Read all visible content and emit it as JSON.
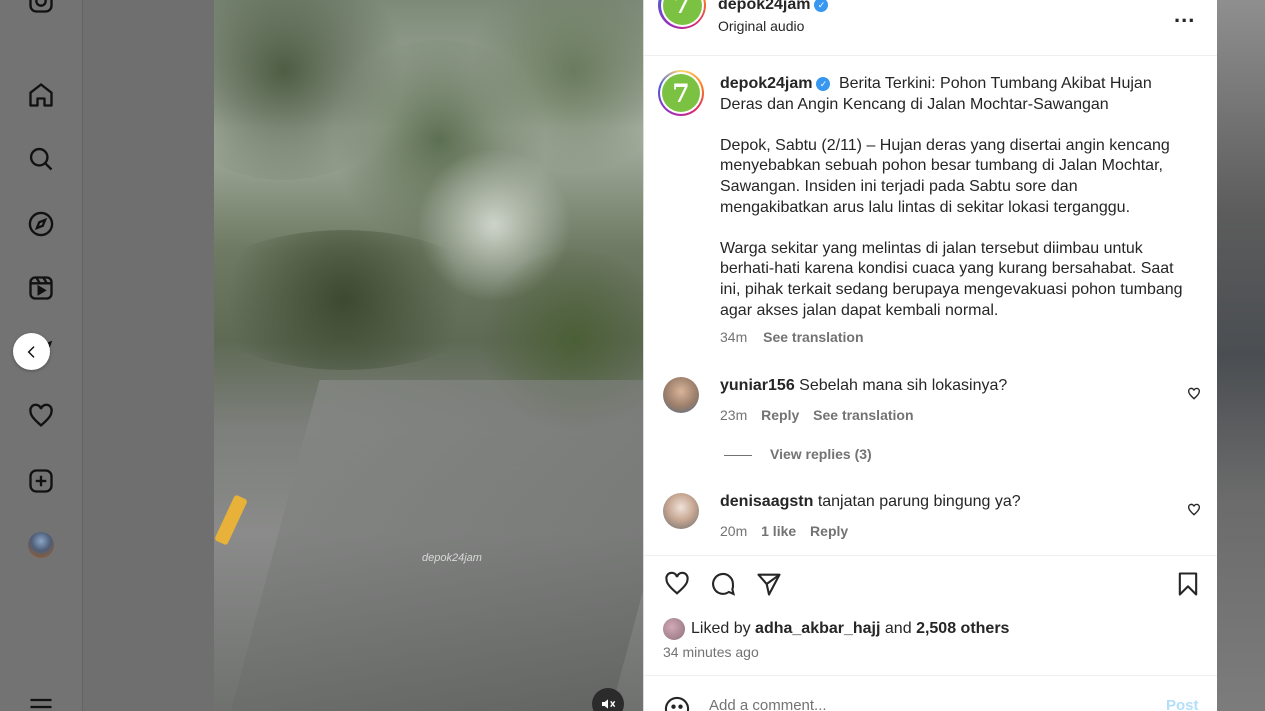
{
  "header": {
    "username": "depok24jam",
    "audio": "Original audio",
    "more_label": "..."
  },
  "caption": {
    "username": "depok24jam",
    "headline": "Berita Terkini: Pohon Tumbang Akibat Hujan Deras dan Angin Kencang di Jalan Mochtar-Sawangan",
    "paragraph_1": "Depok, Sabtu (2/11) – Hujan deras yang disertai angin kencang menyebabkan sebuah pohon besar tumbang di Jalan Mochtar, Sawangan. Insiden ini terjadi pada Sabtu sore dan mengakibatkan arus lalu lintas di sekitar lokasi terganggu.",
    "paragraph_2": "Warga sekitar yang melintas di jalan tersebut diimbau untuk berhati-hati karena kondisi cuaca yang kurang bersahabat. Saat ini, pihak terkait sedang berupaya mengevakuasi pohon tumbang agar akses jalan dapat kembali normal.",
    "time": "34m",
    "see_translation": "See translation"
  },
  "comments": [
    {
      "username": "yuniar156",
      "text": "Sebelah mana sih lokasinya?",
      "time": "23m",
      "reply": "Reply",
      "see_translation": "See translation",
      "view_replies": "View replies (3)"
    },
    {
      "username": "denisaagstn",
      "text": "tanjatan parung bingung ya?",
      "time": "20m",
      "likes": "1 like",
      "reply": "Reply"
    }
  ],
  "likes": {
    "prefix": "Liked by",
    "user": "adha_akbar_hajj",
    "and": "and",
    "others": "2,508 others"
  },
  "timestamp": "34 minutes ago",
  "add_comment": {
    "placeholder": "Add a comment...",
    "post": "Post"
  },
  "video": {
    "watermark": "depok24jam"
  },
  "colors": {
    "verified": "#3897f0",
    "logo_green": "#7cc242",
    "post_disabled": "#b2dffc"
  },
  "logo_text": "7"
}
